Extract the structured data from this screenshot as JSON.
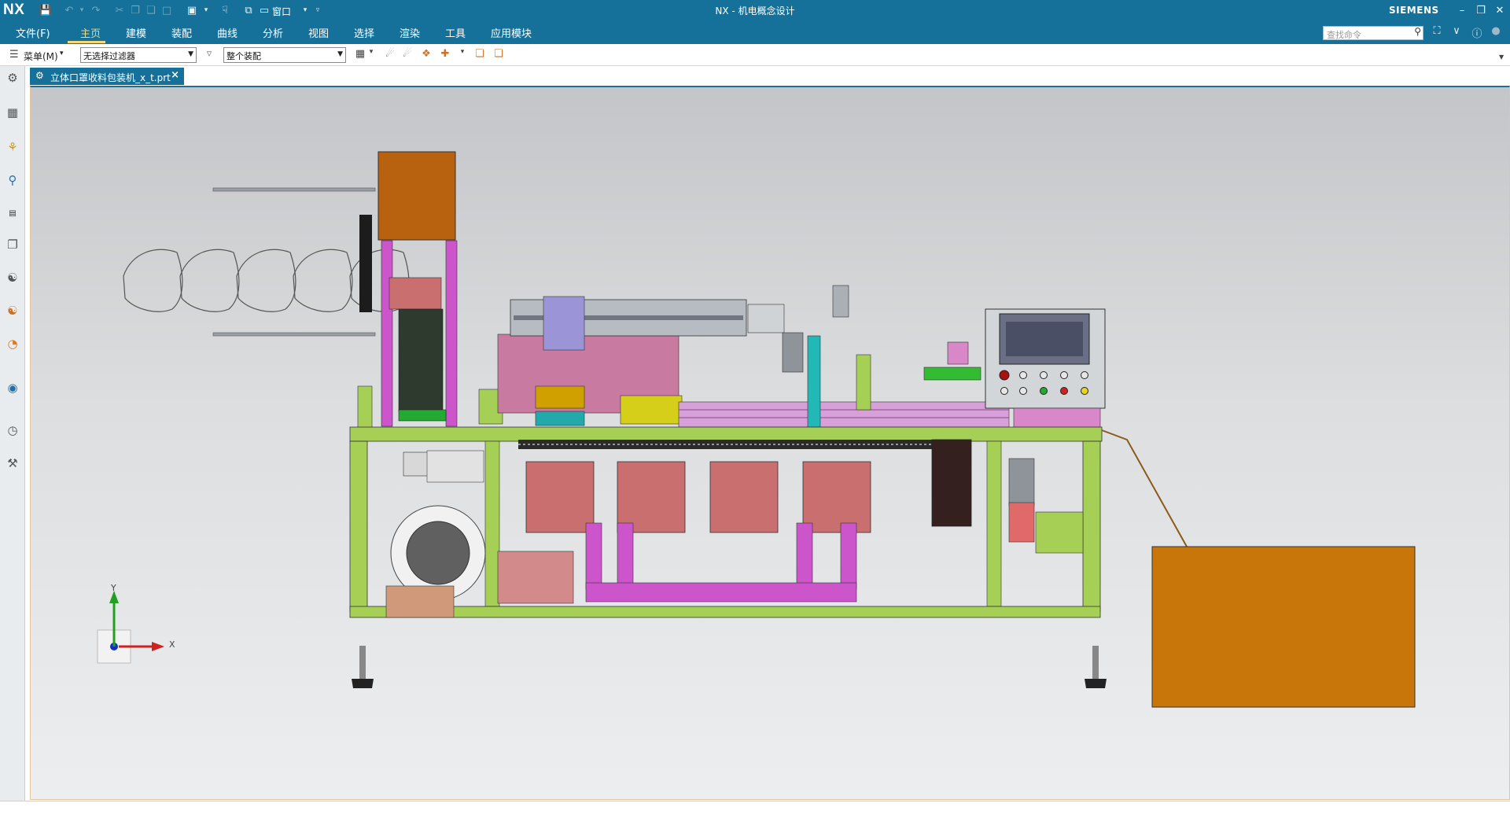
{
  "app": {
    "logo": "NX",
    "window_title": "NX - 机电概念设计",
    "brand": "SIEMENS",
    "window_menu_label": "窗口"
  },
  "ribbon": {
    "tabs": [
      "文件(F)",
      "主页",
      "建模",
      "装配",
      "曲线",
      "分析",
      "视图",
      "选择",
      "渲染",
      "工具",
      "应用模块"
    ],
    "active_tab": "主页",
    "search_placeholder": "查找命令"
  },
  "toolbar": {
    "menu_label": "菜单(M)",
    "filter_value": "无选择过滤器",
    "scope_value": "整个装配"
  },
  "document": {
    "tab_label": "立体口罩收料包装机_x_t.prt"
  },
  "triad": {
    "x_label": "X",
    "y_label": "Y"
  },
  "colors": {
    "title_bar": "#15719a",
    "active_tab_text": "#f7d774",
    "frame_green": "#a6cf56",
    "magenta_parts": "#cc55cc",
    "orange_box": "#c8760a",
    "pink_block": "#c96f6f"
  }
}
